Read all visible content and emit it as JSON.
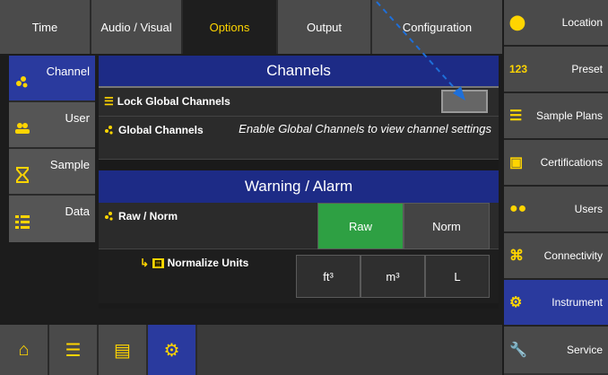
{
  "tabs": [
    {
      "label": "Time"
    },
    {
      "label": "Audio / Visual"
    },
    {
      "label": "Options"
    },
    {
      "label": "Output"
    },
    {
      "label": "Configuration"
    }
  ],
  "subnav": [
    {
      "label": "Channel"
    },
    {
      "label": "User"
    },
    {
      "label": "Sample"
    },
    {
      "label": "Data"
    }
  ],
  "channels": {
    "title": "Channels",
    "lock_label": "Lock Global Channels",
    "global_label": "Global Channels",
    "global_hint": "Enable Global Channels to view channel settings"
  },
  "warning": {
    "title": "Warning / Alarm",
    "raw_norm_label": "Raw / Norm",
    "raw": "Raw",
    "norm": "Norm",
    "normalize_label": "Normalize Units",
    "units": [
      "ft³",
      "m³",
      "L"
    ]
  },
  "sidebar": [
    {
      "label": "Location",
      "icon": "location-pin-icon"
    },
    {
      "label": "Preset",
      "icon": "123-icon",
      "glyph": "123"
    },
    {
      "label": "Sample Plans",
      "icon": "list-icon"
    },
    {
      "label": "Certifications",
      "icon": "certificate-icon"
    },
    {
      "label": "Users",
      "icon": "users-icon"
    },
    {
      "label": "Connectivity",
      "icon": "network-icon"
    },
    {
      "label": "Instrument",
      "icon": "gear-icon"
    },
    {
      "label": "Service",
      "icon": "wrench-icon"
    }
  ],
  "colors": {
    "active_blue": "#2a3a9e",
    "banner_blue": "#1d2b86",
    "accent_yellow": "#ffd500",
    "toggle_green": "#2ea043"
  }
}
